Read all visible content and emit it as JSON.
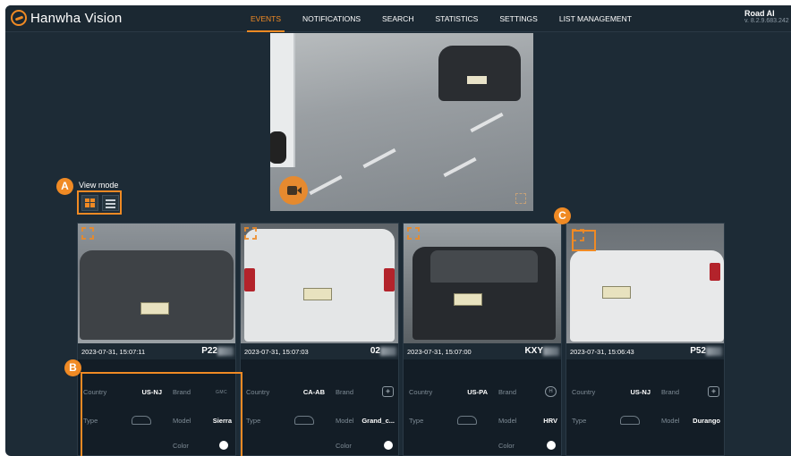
{
  "header": {
    "logo_text": "Hanwha Vision",
    "nav": [
      "EVENTS",
      "NOTIFICATIONS",
      "SEARCH",
      "STATISTICS",
      "SETTINGS",
      "LIST MANAGEMENT"
    ],
    "active_nav": "EVENTS",
    "app_name": "Road AI",
    "app_version": "v. 8.2.9.683.242"
  },
  "view_mode": {
    "label": "View mode",
    "options": [
      "grid-icon",
      "list-icon"
    ],
    "selected": "grid-icon"
  },
  "callouts": [
    "A",
    "B",
    "C"
  ],
  "attribute_labels": {
    "country": "Country",
    "brand": "Brand",
    "type": "Type",
    "model": "Model",
    "color": "Color"
  },
  "cards": [
    {
      "timestamp": "2023-07-31, 15:07:11",
      "plate": "P22",
      "country": "US-NJ",
      "brand": "GMC",
      "model": "Sierra",
      "type_icon": "pickup-icon",
      "color": "#ffffff"
    },
    {
      "timestamp": "2023-07-31, 15:07:03",
      "plate": "02",
      "country": "CA-AB",
      "brand": "Dodge",
      "model": "Grand_c...",
      "type_icon": "minivan-icon",
      "color": "#ffffff"
    },
    {
      "timestamp": "2023-07-31, 15:07:00",
      "plate": "KXY",
      "country": "US-PA",
      "brand": "Honda",
      "model": "HRV",
      "type_icon": "suv-icon",
      "color": "#ffffff"
    },
    {
      "timestamp": "2023-07-31, 15:06:43",
      "plate": "P52",
      "country": "US-NJ",
      "brand": "Dodge",
      "model": "Durango",
      "type_icon": "suv-icon",
      "color": null
    }
  ],
  "colors": {
    "accent": "#f08a24",
    "background": "#1d2b36",
    "card": "#131d26"
  }
}
